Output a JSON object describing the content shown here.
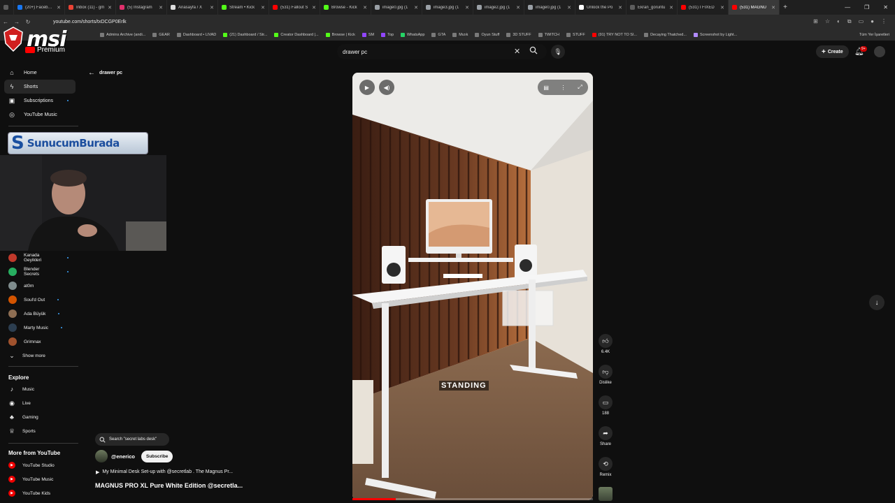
{
  "browser": {
    "tabs": [
      {
        "label": "",
        "color": "#5d5d5d"
      },
      {
        "label": "(20+) Facebook",
        "color": "#1877f2"
      },
      {
        "label": "Inbox (11) - gm",
        "color": "#ea4335"
      },
      {
        "label": "(5) Instagram",
        "color": "#e1306c"
      },
      {
        "label": "Anasayfa / X",
        "color": "#dddddd"
      },
      {
        "label": "Stream • Kick",
        "color": "#53fc18"
      },
      {
        "label": "(531) Fallout S",
        "color": "#ff0000"
      },
      {
        "label": "Browse - Kick",
        "color": "#53fc18"
      },
      {
        "label": "image0.jpg (1",
        "color": "#9aa0a6"
      },
      {
        "label": "image3.jpg (1",
        "color": "#9aa0a6"
      },
      {
        "label": "image2.jpg (1",
        "color": "#9aa0a6"
      },
      {
        "label": "image0.jpg (1",
        "color": "#9aa0a6"
      },
      {
        "label": "Unlock the Po",
        "color": "#ffffff"
      },
      {
        "label": "Ekran_goruntu",
        "color": "#5d5d5d"
      },
      {
        "label": "(531) I FIXED",
        "color": "#ff0000"
      },
      {
        "label": "(531) MAGNU",
        "color": "#ff0000"
      }
    ],
    "new_tab": "+",
    "window_controls": [
      "—",
      "❐",
      "✕"
    ],
    "url": "youtube.com/shorts/txDCGP0Erlk",
    "bookmarks": [
      {
        "label": "Admins Archive (andi...",
        "color": "#7a7a7a"
      },
      {
        "label": "GEAR",
        "color": "#7a7a7a"
      },
      {
        "label": "Dashboard • LIVAD",
        "color": "#7a7a7a"
      },
      {
        "label": "(21) Dashboard / Str...",
        "color": "#53fc18"
      },
      {
        "label": "Creator Dashboard |...",
        "color": "#53fc18"
      },
      {
        "label": "Browse | Kick",
        "color": "#53fc18"
      },
      {
        "label": "SM",
        "color": "#9146ff"
      },
      {
        "label": "Top",
        "color": "#9146ff"
      },
      {
        "label": "WhatsApp",
        "color": "#25d366"
      },
      {
        "label": "GTA",
        "color": "#7a7a7a"
      },
      {
        "label": "Mızık",
        "color": "#7a7a7a"
      },
      {
        "label": "Oyun Stuff",
        "color": "#7a7a7a"
      },
      {
        "label": "3D STUFF",
        "color": "#7a7a7a"
      },
      {
        "label": "TWITCH",
        "color": "#7a7a7a"
      },
      {
        "label": "STUFF",
        "color": "#7a7a7a"
      },
      {
        "label": "(91) TRY NOT TO SI...",
        "color": "#ff0000"
      },
      {
        "label": "Decaying Thatched...",
        "color": "#7a7a7a"
      },
      {
        "label": "Screenshot by Light...",
        "color": "#b28cff"
      }
    ],
    "bookmarks_all": "Tüm Yer İşaretleri"
  },
  "overlay": {
    "msi_text": "msi",
    "banner_s": "S",
    "banner_text": "SunucumBurada"
  },
  "header": {
    "logo_text": "Premium",
    "search_query": "drawer pc",
    "create_label": "Create",
    "notif_count": "9+"
  },
  "sidebar": {
    "main": [
      {
        "label": "Home",
        "icon": "⌂"
      },
      {
        "label": "Shorts",
        "icon": "ϟ"
      },
      {
        "label": "Subscriptions",
        "icon": "▣"
      },
      {
        "label": "YouTube Music",
        "icon": "◎"
      }
    ],
    "subscriptions": [
      {
        "label": "Kanada Geyikleri",
        "color": "#c0392b",
        "dot": true
      },
      {
        "label": "Blender Secrets",
        "color": "#27ae60",
        "dot": true
      },
      {
        "label": "at0m",
        "color": "#7f8c8d",
        "dot": false
      },
      {
        "label": "Soul'd Out",
        "color": "#d35400",
        "dot": true
      },
      {
        "label": "Ada Büyük",
        "color": "#8e6e53",
        "dot": true
      },
      {
        "label": "Marty Music",
        "color": "#2c3e50",
        "dot": true
      },
      {
        "label": "Grimnax",
        "color": "#a0522d",
        "dot": false
      }
    ],
    "show_more": "Show more",
    "explore_title": "Explore",
    "explore": [
      {
        "label": "Music",
        "icon": "♪"
      },
      {
        "label": "Live",
        "icon": "◉"
      },
      {
        "label": "Gaming",
        "icon": "♣"
      },
      {
        "label": "Sports",
        "icon": "♕"
      }
    ],
    "more_title": "More from YouTube",
    "more": [
      {
        "label": "YouTube Studio"
      },
      {
        "label": "YouTube Music"
      },
      {
        "label": "YouTube Kids"
      }
    ]
  },
  "back_label": "drawer pc",
  "player": {
    "caption": "STANDING",
    "progress": 0.18
  },
  "actions": {
    "like_count": "6.4K",
    "dislike_label": "Dislike",
    "comment_count": "188",
    "share_label": "Share",
    "remix_label": "Remix"
  },
  "info": {
    "search_chip": "Search \"secret labs desk\"",
    "channel": "@enerico",
    "subscribe": "Subscribe",
    "video_link": "My Minimal Desk Set-up with @secretlab . The Magnus Pr...",
    "title": "MAGNUS PRO XL Pure White Edition @secretla..."
  }
}
